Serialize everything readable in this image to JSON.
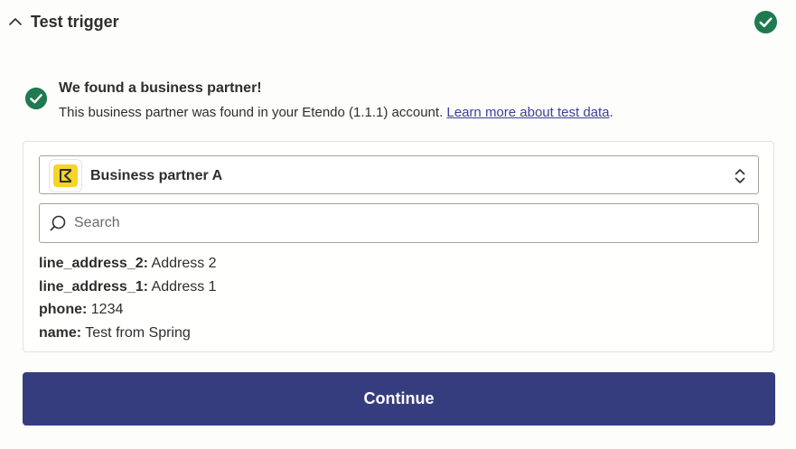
{
  "header": {
    "title": "Test trigger",
    "collapse_icon": "chevron-up-icon",
    "status_icon": "check-circle-icon"
  },
  "result": {
    "title": "We found a business partner!",
    "description_prefix": "This business partner was found in your Etendo (1.1.1) account. ",
    "link_text": "Learn more about test data",
    "description_suffix": "."
  },
  "record_select": {
    "app_icon": "etendo-logo-icon",
    "selected": "Business partner A"
  },
  "search": {
    "placeholder": "Search",
    "value": ""
  },
  "fields": [
    {
      "key": "line_address_2:",
      "value": "Address 2"
    },
    {
      "key": "line_address_1:",
      "value": "Address 1"
    },
    {
      "key": "phone:",
      "value": "1234"
    },
    {
      "key": "name:",
      "value": "Test from Spring"
    }
  ],
  "actions": {
    "continue_label": "Continue"
  },
  "colors": {
    "success": "#1f7a4f",
    "primary_button": "#363d7f",
    "link": "#3b3f9e",
    "app_icon_bg": "#f8d32b"
  }
}
